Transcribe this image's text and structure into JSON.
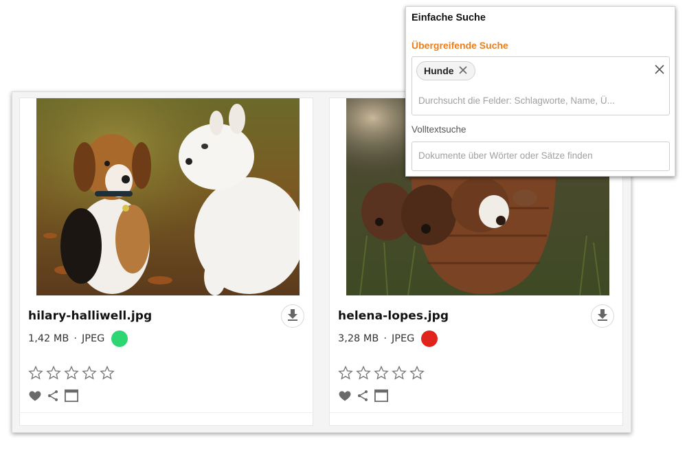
{
  "assets": [
    {
      "filename": "hilary-halliwell.jpg",
      "size": "1,42 MB",
      "separator": "·",
      "format": "JPEG",
      "status_color": "#2ed573",
      "rating": 0,
      "icons": {
        "download": "download-icon",
        "favorite": "heart-icon",
        "share": "share-icon",
        "preview": "window-icon"
      }
    },
    {
      "filename": "helena-lopes.jpg",
      "size": "3,28 MB",
      "separator": "·",
      "format": "JPEG",
      "status_color": "#e0231c",
      "rating": 0,
      "icons": {
        "download": "download-icon",
        "favorite": "heart-icon",
        "share": "share-icon",
        "preview": "window-icon"
      }
    }
  ],
  "search": {
    "simple_label": "Einfache Suche",
    "global_label": "Übergreifende Suche",
    "global_tag": "Hunde",
    "global_placeholder": "Durchsucht die Felder: Schlagworte, Name, Ü...",
    "fulltext_label": "Volltextsuche",
    "fulltext_placeholder": "Dokumente über Wörter oder Sätze finden",
    "accent_color": "#f07d1a"
  }
}
